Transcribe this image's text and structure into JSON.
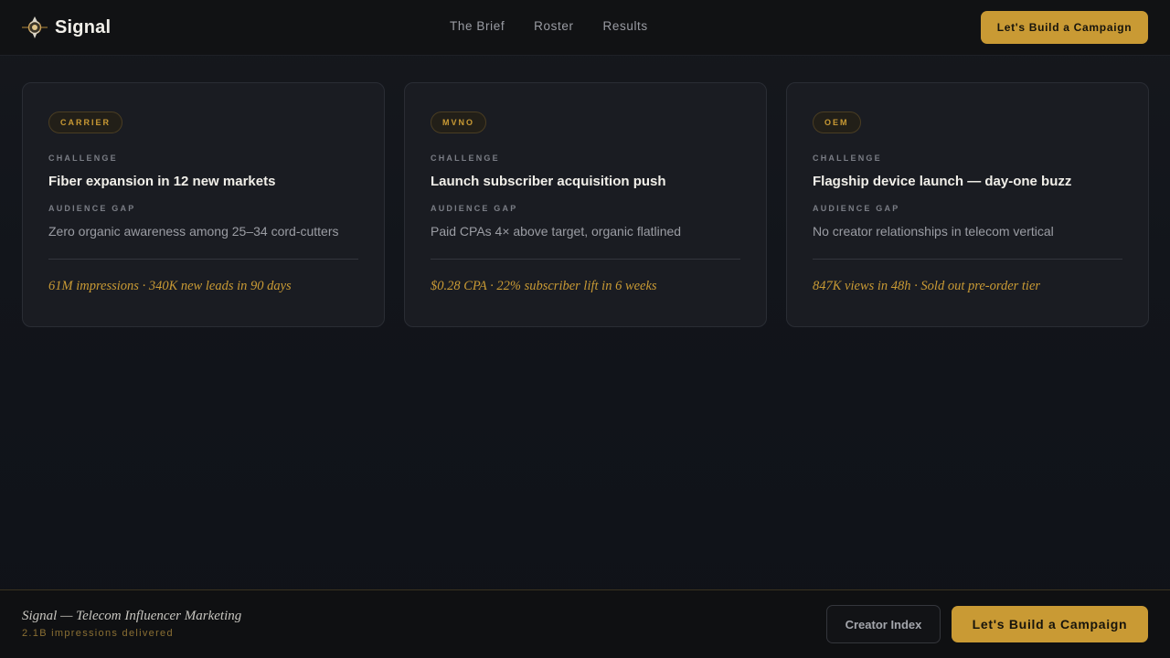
{
  "header": {
    "brand": "Signal",
    "logo_icon": "radio-tower-logo-icon",
    "nav": [
      "The Brief",
      "Roster",
      "Results"
    ],
    "cta_label": "Let's Build a Campaign"
  },
  "cards": [
    {
      "tag": "CARRIER",
      "challenge_label": "CHALLENGE",
      "challenge": "Fiber expansion in 12 new markets",
      "gap_label": "AUDIENCE GAP",
      "gap": "Zero organic awareness among 25–34 cord-cutters",
      "result": "61M impressions · 340K new leads in 90 days"
    },
    {
      "tag": "MVNO",
      "challenge_label": "CHALLENGE",
      "challenge": "Launch subscriber acquisition push",
      "gap_label": "AUDIENCE GAP",
      "gap": "Paid CPAs 4× above target, organic flatlined",
      "result": "$0.28 CPA · 22% subscriber lift in 6 weeks"
    },
    {
      "tag": "OEM",
      "challenge_label": "CHALLENGE",
      "challenge": "Flagship device launch — day-one buzz",
      "gap_label": "AUDIENCE GAP",
      "gap": "No creator relationships in telecom vertical",
      "result": "847K views in 48h · Sold out pre-order tier"
    }
  ],
  "footer": {
    "title": "Signal — Telecom Influencer Marketing",
    "subtitle": "2.1B impressions delivered",
    "secondary_label": "Creator Index",
    "primary_label": "Let's Build a Campaign"
  },
  "colors": {
    "accent": "#c99a34",
    "background": "#12151b",
    "card": "#1a1c22"
  }
}
